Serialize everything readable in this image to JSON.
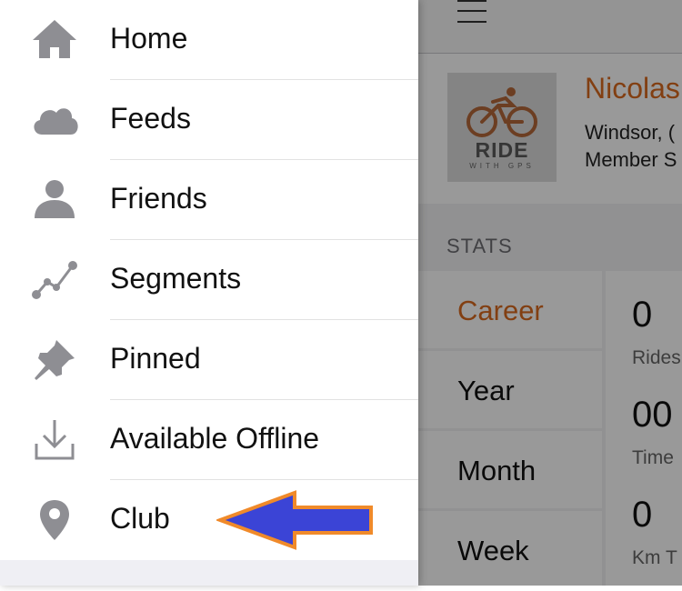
{
  "menu": {
    "items": [
      {
        "label": "Home",
        "icon": "home-icon"
      },
      {
        "label": "Feeds",
        "icon": "cloud-icon"
      },
      {
        "label": "Friends",
        "icon": "person-icon"
      },
      {
        "label": "Segments",
        "icon": "segments-icon"
      },
      {
        "label": "Pinned",
        "icon": "pin-icon"
      },
      {
        "label": "Available Offline",
        "icon": "download-icon"
      },
      {
        "label": "Club",
        "icon": "location-marker-icon"
      }
    ]
  },
  "annotation": {
    "arrow_fill": "#3b44d6",
    "arrow_stroke": "#f08a2a",
    "points_to": "Club"
  },
  "profile": {
    "logo_text": "RIDE",
    "logo_subtext": "WITH GPS",
    "name": "Nicolas",
    "location": "Windsor, (",
    "member": "Member S"
  },
  "stats": {
    "heading": "STATS",
    "periods": [
      {
        "label": "Career",
        "active": true
      },
      {
        "label": "Year",
        "active": false
      },
      {
        "label": "Month",
        "active": false
      },
      {
        "label": "Week",
        "active": false
      }
    ],
    "values": [
      {
        "value": "0",
        "label": "Rides"
      },
      {
        "value": "00",
        "label": "Time"
      },
      {
        "value": "0",
        "label": "Km T"
      }
    ]
  },
  "colors": {
    "accent": "#d96a1f",
    "icon_gray": "#8e8e93"
  }
}
